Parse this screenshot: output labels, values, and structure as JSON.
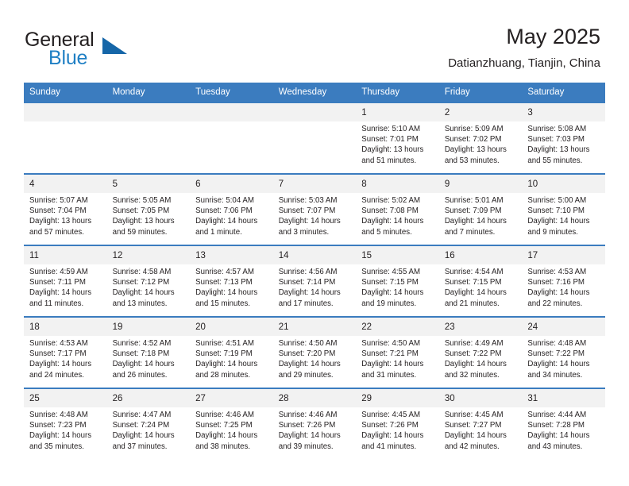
{
  "brand": {
    "name_part1": "General",
    "name_part2": "Blue",
    "logo_icon": "triangle-flag-icon",
    "accent_color": "#1f7fc4"
  },
  "header": {
    "title": "May 2025",
    "subtitle": "Datianzhuang, Tianjin, China"
  },
  "theme": {
    "header_row_bg": "#3b7cbf",
    "cell_shade_bg": "#f2f2f2",
    "text_color": "#231f20"
  },
  "weekdays": [
    "Sunday",
    "Monday",
    "Tuesday",
    "Wednesday",
    "Thursday",
    "Friday",
    "Saturday"
  ],
  "weeks": [
    [
      {
        "day": "",
        "sunrise": "",
        "sunset": "",
        "daylight1": "",
        "daylight2": ""
      },
      {
        "day": "",
        "sunrise": "",
        "sunset": "",
        "daylight1": "",
        "daylight2": ""
      },
      {
        "day": "",
        "sunrise": "",
        "sunset": "",
        "daylight1": "",
        "daylight2": ""
      },
      {
        "day": "",
        "sunrise": "",
        "sunset": "",
        "daylight1": "",
        "daylight2": ""
      },
      {
        "day": "1",
        "sunrise": "Sunrise: 5:10 AM",
        "sunset": "Sunset: 7:01 PM",
        "daylight1": "Daylight: 13 hours",
        "daylight2": "and 51 minutes."
      },
      {
        "day": "2",
        "sunrise": "Sunrise: 5:09 AM",
        "sunset": "Sunset: 7:02 PM",
        "daylight1": "Daylight: 13 hours",
        "daylight2": "and 53 minutes."
      },
      {
        "day": "3",
        "sunrise": "Sunrise: 5:08 AM",
        "sunset": "Sunset: 7:03 PM",
        "daylight1": "Daylight: 13 hours",
        "daylight2": "and 55 minutes."
      }
    ],
    [
      {
        "day": "4",
        "sunrise": "Sunrise: 5:07 AM",
        "sunset": "Sunset: 7:04 PM",
        "daylight1": "Daylight: 13 hours",
        "daylight2": "and 57 minutes."
      },
      {
        "day": "5",
        "sunrise": "Sunrise: 5:05 AM",
        "sunset": "Sunset: 7:05 PM",
        "daylight1": "Daylight: 13 hours",
        "daylight2": "and 59 minutes."
      },
      {
        "day": "6",
        "sunrise": "Sunrise: 5:04 AM",
        "sunset": "Sunset: 7:06 PM",
        "daylight1": "Daylight: 14 hours",
        "daylight2": "and 1 minute."
      },
      {
        "day": "7",
        "sunrise": "Sunrise: 5:03 AM",
        "sunset": "Sunset: 7:07 PM",
        "daylight1": "Daylight: 14 hours",
        "daylight2": "and 3 minutes."
      },
      {
        "day": "8",
        "sunrise": "Sunrise: 5:02 AM",
        "sunset": "Sunset: 7:08 PM",
        "daylight1": "Daylight: 14 hours",
        "daylight2": "and 5 minutes."
      },
      {
        "day": "9",
        "sunrise": "Sunrise: 5:01 AM",
        "sunset": "Sunset: 7:09 PM",
        "daylight1": "Daylight: 14 hours",
        "daylight2": "and 7 minutes."
      },
      {
        "day": "10",
        "sunrise": "Sunrise: 5:00 AM",
        "sunset": "Sunset: 7:10 PM",
        "daylight1": "Daylight: 14 hours",
        "daylight2": "and 9 minutes."
      }
    ],
    [
      {
        "day": "11",
        "sunrise": "Sunrise: 4:59 AM",
        "sunset": "Sunset: 7:11 PM",
        "daylight1": "Daylight: 14 hours",
        "daylight2": "and 11 minutes."
      },
      {
        "day": "12",
        "sunrise": "Sunrise: 4:58 AM",
        "sunset": "Sunset: 7:12 PM",
        "daylight1": "Daylight: 14 hours",
        "daylight2": "and 13 minutes."
      },
      {
        "day": "13",
        "sunrise": "Sunrise: 4:57 AM",
        "sunset": "Sunset: 7:13 PM",
        "daylight1": "Daylight: 14 hours",
        "daylight2": "and 15 minutes."
      },
      {
        "day": "14",
        "sunrise": "Sunrise: 4:56 AM",
        "sunset": "Sunset: 7:14 PM",
        "daylight1": "Daylight: 14 hours",
        "daylight2": "and 17 minutes."
      },
      {
        "day": "15",
        "sunrise": "Sunrise: 4:55 AM",
        "sunset": "Sunset: 7:15 PM",
        "daylight1": "Daylight: 14 hours",
        "daylight2": "and 19 minutes."
      },
      {
        "day": "16",
        "sunrise": "Sunrise: 4:54 AM",
        "sunset": "Sunset: 7:15 PM",
        "daylight1": "Daylight: 14 hours",
        "daylight2": "and 21 minutes."
      },
      {
        "day": "17",
        "sunrise": "Sunrise: 4:53 AM",
        "sunset": "Sunset: 7:16 PM",
        "daylight1": "Daylight: 14 hours",
        "daylight2": "and 22 minutes."
      }
    ],
    [
      {
        "day": "18",
        "sunrise": "Sunrise: 4:53 AM",
        "sunset": "Sunset: 7:17 PM",
        "daylight1": "Daylight: 14 hours",
        "daylight2": "and 24 minutes."
      },
      {
        "day": "19",
        "sunrise": "Sunrise: 4:52 AM",
        "sunset": "Sunset: 7:18 PM",
        "daylight1": "Daylight: 14 hours",
        "daylight2": "and 26 minutes."
      },
      {
        "day": "20",
        "sunrise": "Sunrise: 4:51 AM",
        "sunset": "Sunset: 7:19 PM",
        "daylight1": "Daylight: 14 hours",
        "daylight2": "and 28 minutes."
      },
      {
        "day": "21",
        "sunrise": "Sunrise: 4:50 AM",
        "sunset": "Sunset: 7:20 PM",
        "daylight1": "Daylight: 14 hours",
        "daylight2": "and 29 minutes."
      },
      {
        "day": "22",
        "sunrise": "Sunrise: 4:50 AM",
        "sunset": "Sunset: 7:21 PM",
        "daylight1": "Daylight: 14 hours",
        "daylight2": "and 31 minutes."
      },
      {
        "day": "23",
        "sunrise": "Sunrise: 4:49 AM",
        "sunset": "Sunset: 7:22 PM",
        "daylight1": "Daylight: 14 hours",
        "daylight2": "and 32 minutes."
      },
      {
        "day": "24",
        "sunrise": "Sunrise: 4:48 AM",
        "sunset": "Sunset: 7:22 PM",
        "daylight1": "Daylight: 14 hours",
        "daylight2": "and 34 minutes."
      }
    ],
    [
      {
        "day": "25",
        "sunrise": "Sunrise: 4:48 AM",
        "sunset": "Sunset: 7:23 PM",
        "daylight1": "Daylight: 14 hours",
        "daylight2": "and 35 minutes."
      },
      {
        "day": "26",
        "sunrise": "Sunrise: 4:47 AM",
        "sunset": "Sunset: 7:24 PM",
        "daylight1": "Daylight: 14 hours",
        "daylight2": "and 37 minutes."
      },
      {
        "day": "27",
        "sunrise": "Sunrise: 4:46 AM",
        "sunset": "Sunset: 7:25 PM",
        "daylight1": "Daylight: 14 hours",
        "daylight2": "and 38 minutes."
      },
      {
        "day": "28",
        "sunrise": "Sunrise: 4:46 AM",
        "sunset": "Sunset: 7:26 PM",
        "daylight1": "Daylight: 14 hours",
        "daylight2": "and 39 minutes."
      },
      {
        "day": "29",
        "sunrise": "Sunrise: 4:45 AM",
        "sunset": "Sunset: 7:26 PM",
        "daylight1": "Daylight: 14 hours",
        "daylight2": "and 41 minutes."
      },
      {
        "day": "30",
        "sunrise": "Sunrise: 4:45 AM",
        "sunset": "Sunset: 7:27 PM",
        "daylight1": "Daylight: 14 hours",
        "daylight2": "and 42 minutes."
      },
      {
        "day": "31",
        "sunrise": "Sunrise: 4:44 AM",
        "sunset": "Sunset: 7:28 PM",
        "daylight1": "Daylight: 14 hours",
        "daylight2": "and 43 minutes."
      }
    ]
  ]
}
